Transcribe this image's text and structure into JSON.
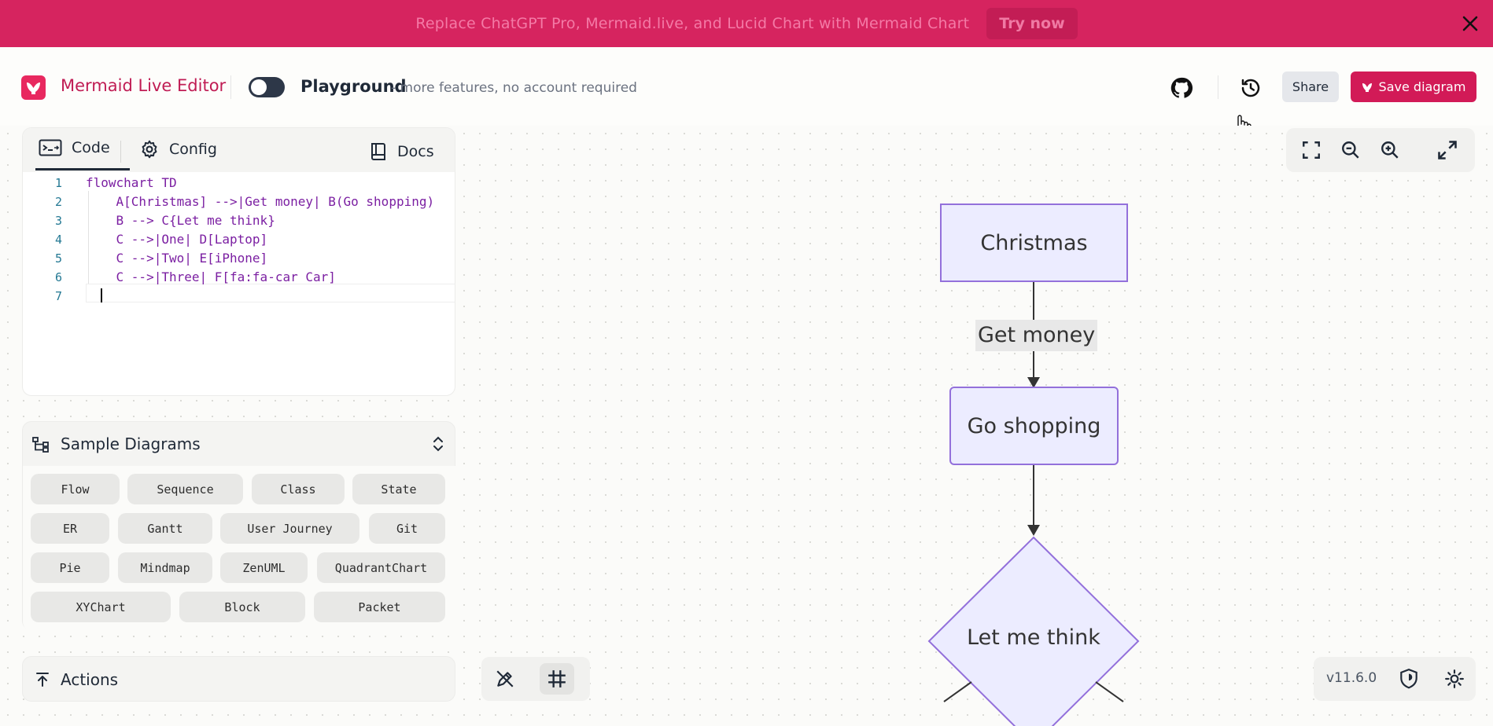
{
  "banner": {
    "text": "Replace ChatGPT Pro, Mermaid.live, and Lucid Chart with Mermaid Chart",
    "cta": "Try now"
  },
  "header": {
    "title": "Mermaid Live Editor",
    "playground_label": "Playground",
    "playground_sub": "- more features, no account required",
    "share_label": "Share",
    "save_label": "Save diagram"
  },
  "editor": {
    "tabs": {
      "code": "Code",
      "config": "Config",
      "docs": "Docs"
    },
    "lines": [
      {
        "n": "1",
        "text": "flowchart TD"
      },
      {
        "n": "2",
        "text": "    A[Christmas] -->|Get money| B(Go shopping)"
      },
      {
        "n": "3",
        "text": "    B --> C{Let me think}"
      },
      {
        "n": "4",
        "text": "    C -->|One| D[Laptop]"
      },
      {
        "n": "5",
        "text": "    C -->|Two| E[iPhone]"
      },
      {
        "n": "6",
        "text": "    C -->|Three| F[fa:fa-car Car]"
      },
      {
        "n": "7",
        "text": ""
      }
    ]
  },
  "samples": {
    "title": "Sample Diagrams",
    "items": [
      "Flow",
      "Sequence",
      "Class",
      "State",
      "ER",
      "Gantt",
      "User Journey",
      "Git",
      "Pie",
      "Mindmap",
      "ZenUML",
      "QuadrantChart",
      "XYChart",
      "Block",
      "Packet"
    ]
  },
  "actions": {
    "title": "Actions"
  },
  "version": "v11.6.0",
  "diagram": {
    "nodes": {
      "a": "Christmas",
      "b": "Go shopping",
      "c": "Let me think"
    },
    "edge_labels": {
      "ab": "Get money"
    }
  },
  "colors": {
    "brand": "#d21a57",
    "banner": "#d6245f",
    "node_fill": "#ececff",
    "node_stroke": "#9370db"
  }
}
